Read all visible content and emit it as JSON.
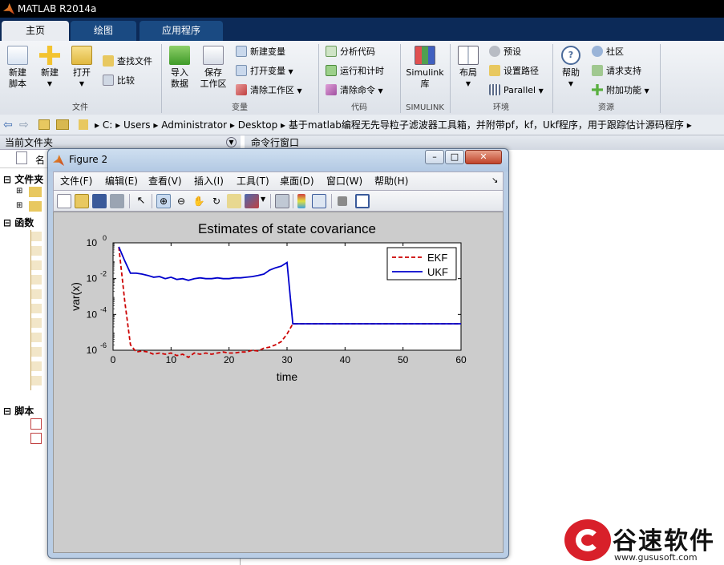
{
  "app": {
    "title": "MATLAB R2014a"
  },
  "tabs": [
    {
      "label": "主页"
    },
    {
      "label": "绘图"
    },
    {
      "label": "应用程序"
    }
  ],
  "ribbon": {
    "file": {
      "new_script": "新建\n脚本",
      "new": "新建",
      "open": "打开",
      "find_files": "查找文件",
      "compare": "比较",
      "group": "文件"
    },
    "variable": {
      "import": "导入\n数据",
      "save_ws": "保存\n工作区",
      "new_var": "新建变量",
      "open_var": "打开变量",
      "clear_ws": "清除工作区",
      "group": "变量"
    },
    "code": {
      "analyze": "分析代码",
      "run_time": "运行和计时",
      "clear_cmd": "清除命令",
      "group": "代码"
    },
    "simulink": {
      "label": "Simulink\n库",
      "group": "SIMULINK"
    },
    "env": {
      "layout": "布局",
      "prefs": "预设",
      "set_path": "设置路径",
      "parallel": "Parallel",
      "group": "环境"
    },
    "resources": {
      "help": "帮助",
      "community": "社区",
      "support": "请求支持",
      "addons": "附加功能",
      "group": "资源"
    }
  },
  "address": {
    "segments": [
      "C:",
      "Users",
      "Administrator",
      "Desktop",
      "基于matlab编程无先导粒子滤波器工具箱，并附带pf，kf，Ukf程序，用于跟踪估计源码程序"
    ]
  },
  "left_panel": {
    "title": "当前文件夹",
    "col": "名",
    "folders_label": "文件夹",
    "functions_label": "函数",
    "scripts_label": "脚本"
  },
  "cmd_panel": {
    "title": "命令行窗口"
  },
  "figure": {
    "title": "Figure 2",
    "menu": [
      "文件(F)",
      "编辑(E)",
      "查看(V)",
      "插入(I)",
      "工具(T)",
      "桌面(D)",
      "窗口(W)",
      "帮助(H)"
    ]
  },
  "chart_data": {
    "type": "line",
    "title": "Estimates of state covariance",
    "xlabel": "time",
    "ylabel": "var(x)",
    "xlim": [
      0,
      60
    ],
    "ylim_log10": [
      -6,
      0
    ],
    "yscale": "log",
    "xticks": [
      "0",
      "10",
      "20",
      "30",
      "40",
      "50",
      "60"
    ],
    "yticks": [
      {
        "base": "10",
        "exp": "0"
      },
      {
        "base": "10",
        "exp": "-2"
      },
      {
        "base": "10",
        "exp": "-4"
      },
      {
        "base": "10",
        "exp": "-6"
      }
    ],
    "legend": {
      "position": "top-right"
    },
    "series": [
      {
        "name": "EKF",
        "color": "#cc0000",
        "style": "dashed",
        "x": [
          1,
          2,
          3,
          4,
          5,
          6,
          7,
          8,
          9,
          10,
          11,
          12,
          13,
          14,
          15,
          16,
          17,
          18,
          19,
          20,
          21,
          22,
          23,
          24,
          25,
          26,
          27,
          28,
          29,
          30,
          31,
          40,
          50,
          60
        ],
        "y": [
          0.6,
          0.0006,
          2e-06,
          8e-07,
          9e-07,
          8e-07,
          6e-07,
          7e-07,
          6e-07,
          7e-07,
          5e-07,
          6e-07,
          4e-07,
          7e-07,
          6e-07,
          7e-07,
          6e-07,
          7e-07,
          8e-07,
          7e-07,
          7e-07,
          8e-07,
          8e-07,
          1e-06,
          9e-07,
          1.3e-06,
          1.5e-06,
          2e-06,
          3e-06,
          8e-06,
          3e-05,
          3e-05,
          3e-05,
          3e-05
        ]
      },
      {
        "name": "UKF",
        "color": "#0000cc",
        "style": "solid",
        "x": [
          1,
          2,
          3,
          4,
          5,
          6,
          7,
          8,
          9,
          10,
          11,
          12,
          13,
          14,
          15,
          16,
          17,
          18,
          19,
          20,
          21,
          22,
          23,
          24,
          25,
          26,
          27,
          28,
          29,
          30,
          31,
          40,
          50,
          60
        ],
        "y": [
          0.6,
          0.1,
          0.02,
          0.02,
          0.018,
          0.015,
          0.012,
          0.013,
          0.01,
          0.012,
          0.009,
          0.01,
          0.008,
          0.01,
          0.011,
          0.01,
          0.01,
          0.011,
          0.01,
          0.01,
          0.011,
          0.011,
          0.012,
          0.013,
          0.015,
          0.018,
          0.03,
          0.04,
          0.05,
          0.08,
          3e-05,
          3e-05,
          3e-05,
          3e-05
        ]
      }
    ]
  },
  "watermark": {
    "text": "谷速软件",
    "url": "www.gususoft.com"
  }
}
